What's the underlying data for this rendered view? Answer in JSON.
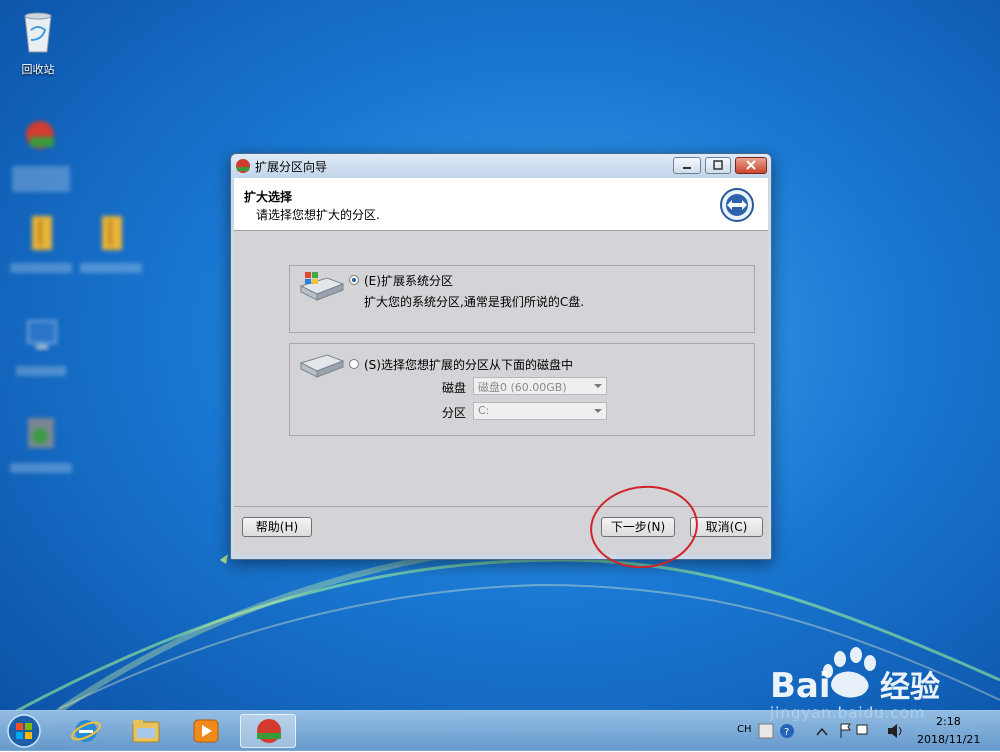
{
  "desktop": {
    "recycle_bin_label": "回收站"
  },
  "window": {
    "title": "扩展分区向导",
    "header_title": "扩大选择",
    "header_subtitle": "请选择您想扩大的分区.",
    "option1_label": "(E)扩展系统分区",
    "option1_desc": "扩大您的系统分区,通常是我们所说的C盘.",
    "option2_label": "(S)选择您想扩展的分区从下面的磁盘中",
    "disk_label": "磁盘",
    "disk_value": "磁盘0 (60.00GB)",
    "partition_label": "分区",
    "partition_value": "C:",
    "help_button": "帮助(H)",
    "next_button": "下一步(N)",
    "cancel_button": "取消(C)"
  },
  "taskbar": {
    "lang": "CH",
    "time": "2:18",
    "date": "2018/11/21"
  },
  "watermark": {
    "text": "jingyan.baidu.com"
  },
  "colors": {
    "accent": "#1a78d2",
    "annotation": "#d0242a"
  }
}
